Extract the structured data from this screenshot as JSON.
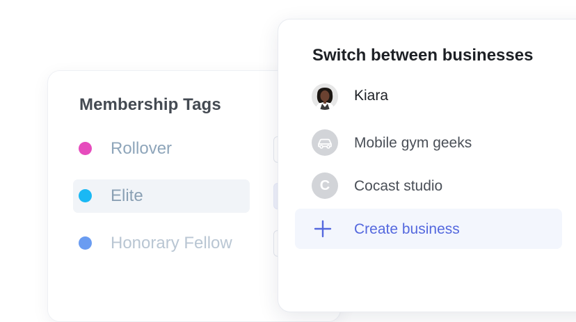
{
  "membership_tags": {
    "title": "Membership Tags",
    "tags": [
      {
        "label": "Rollover",
        "dot_color": "#e64cbd",
        "text_color": "#8ea5ba"
      },
      {
        "label": "Elite",
        "dot_color": "#1ab8f4",
        "text_color": "#8aa0b4",
        "selected": true
      },
      {
        "label": "Honorary Fellow",
        "dot_color": "#6a9cf1",
        "text_color": "#b9c6d3"
      }
    ]
  },
  "business_switcher": {
    "title": "Switch between businesses",
    "businesses": [
      {
        "label": "Kiara",
        "avatar": "profile-photo"
      },
      {
        "label": "Mobile gym geeks",
        "avatar": "car-icon"
      },
      {
        "label": "Cocast studio",
        "avatar_letter": "C"
      }
    ],
    "create": {
      "label": "Create business",
      "icon": "plus-icon"
    }
  },
  "colors": {
    "accent": "#5468de",
    "selected_row_bg": "#f1f4f8",
    "create_row_bg": "#f3f6fd",
    "avatar_gray": "#d2d4d8"
  }
}
